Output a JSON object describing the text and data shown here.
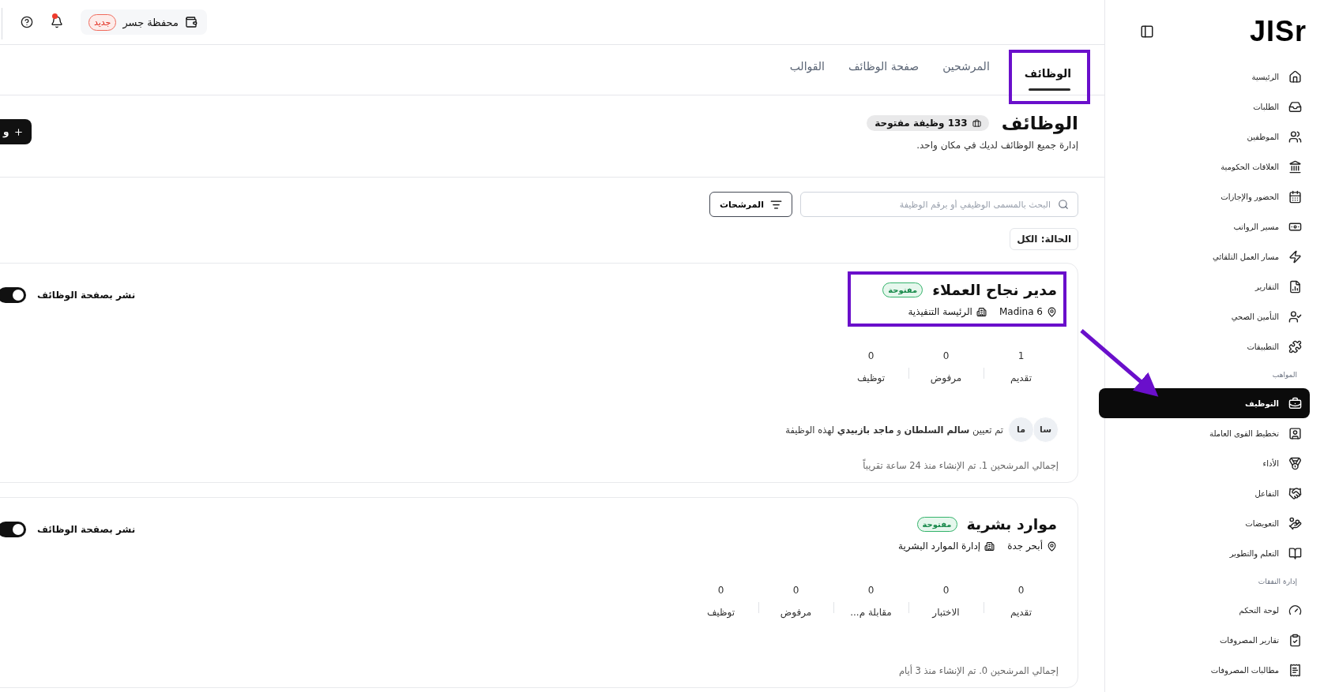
{
  "sidebar": {
    "logo": "JISr",
    "groups": [
      {
        "items": [
          {
            "label": "الرئيسية",
            "selected": false
          },
          {
            "label": "الطلبات",
            "selected": false
          },
          {
            "label": "الموظفين",
            "selected": false
          },
          {
            "label": "العلاقات الحكومية",
            "selected": false
          },
          {
            "label": "الحضور والإجازات",
            "selected": false
          },
          {
            "label": "مسير الرواتب",
            "selected": false
          },
          {
            "label": "مسار العمل التلقائي",
            "selected": false
          },
          {
            "label": "التقارير",
            "selected": false
          },
          {
            "label": "التأمين الصحي",
            "selected": false
          },
          {
            "label": "التطبيقات",
            "selected": false
          }
        ]
      },
      {
        "heading": "المواهب",
        "items": [
          {
            "label": "التوظيف",
            "selected": true,
            "pointed": true
          },
          {
            "label": "تخطيط القوى العاملة",
            "selected": false
          },
          {
            "label": "الأداء",
            "selected": false
          },
          {
            "label": "التفاعل",
            "selected": false
          },
          {
            "label": "التعويضات",
            "selected": false
          },
          {
            "label": "التعلم والتطوير",
            "selected": false
          }
        ]
      },
      {
        "heading": "إدارة النفقات",
        "items": [
          {
            "label": "لوحة التحكم",
            "selected": false
          },
          {
            "label": "تقارير المصروفات",
            "selected": false
          },
          {
            "label": "مطالبات المصروفات",
            "selected": false
          }
        ]
      }
    ]
  },
  "top_bar": {
    "wallet": {
      "label": "محفظة جسر",
      "badge": "جديد"
    },
    "notifications": {
      "unread": true
    }
  },
  "tabs": [
    {
      "label": "الوظائف",
      "selected": true,
      "highlighted": true
    },
    {
      "label": "المرشحين",
      "selected": false,
      "highlighted": false
    },
    {
      "label": "صفحة الوظائف",
      "selected": false,
      "highlighted": false
    },
    {
      "label": "القوالب",
      "selected": false,
      "highlighted": false
    }
  ],
  "header": {
    "title": "الوظائف",
    "count_badge": "133 وظيفة مفتوحة",
    "subtitle": "إدارة جميع الوظائف لديك في مكان واحد.",
    "new_button": "و"
  },
  "search": {
    "placeholder": "البحث بالمسمى الوظيفي أو برقم الوظيفة"
  },
  "filters_button": "المرشحات",
  "status_filter": "الحالة: الكل",
  "jobs": [
    {
      "title": "مدير نجاح العملاء",
      "status": "مفتوحة",
      "location": "Madina 6",
      "department": "الرئيسة التنفيذية",
      "highlighted": true,
      "publish_label": "نشر بصفحة الوظائف",
      "published": true,
      "stages": [
        {
          "count": "1",
          "label": "تقديم"
        },
        {
          "count": "0",
          "label": "مرفوض"
        },
        {
          "count": "0",
          "label": "توظيف"
        }
      ],
      "assignees": {
        "avatars": [
          "سا",
          "ما"
        ],
        "text": "تم تعيين **سالم السلطان** و **ماجد بازبيدي** لهذه الوظيفة"
      },
      "footer": "إجمالي المرشحين 1. تم الإنشاء منذ 24 ساعة تقريباً"
    },
    {
      "title": "موارد بشرية",
      "status": "مفتوحة",
      "location": "أبحر جدة",
      "department": "إدارة الموارد البشرية",
      "highlighted": false,
      "publish_label": "نشر بصفحة الوظائف",
      "published": true,
      "stages": [
        {
          "count": "0",
          "label": "تقديم"
        },
        {
          "count": "0",
          "label": "الاختبار"
        },
        {
          "count": "0",
          "label": "مقابلة م..."
        },
        {
          "count": "0",
          "label": "مرفوض"
        },
        {
          "count": "0",
          "label": "توظيف"
        }
      ],
      "footer": "إجمالي المرشحين 0. تم الإنشاء منذ 3 أيام"
    }
  ]
}
